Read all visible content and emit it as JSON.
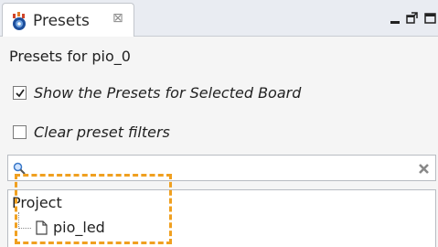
{
  "view": {
    "tab_title": "Presets",
    "tab_close_glyph": "⊠",
    "heading": "Presets for pio_0",
    "show_presets_label": "Show the Presets for Selected Board",
    "show_presets_checked": true,
    "clear_filters_label": "Clear preset filters",
    "clear_filters_checked": false,
    "search_value": "",
    "search_placeholder": "",
    "tree": {
      "root_label": "Project",
      "items": [
        {
          "label": "pio_led"
        }
      ]
    },
    "highlight_color": "#f0a020"
  },
  "icons": [
    "presets-icon",
    "close-icon",
    "minimize-icon",
    "restore-icon",
    "maximize-icon",
    "checkmark-icon",
    "search-icon",
    "clear-icon",
    "file-icon"
  ]
}
